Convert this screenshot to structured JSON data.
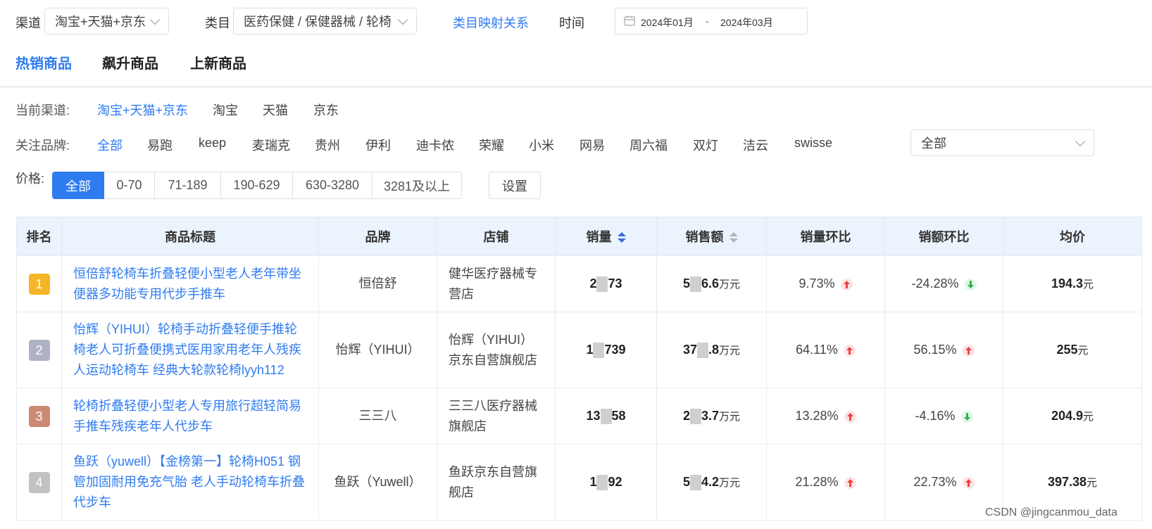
{
  "filters": {
    "channel_label": "渠道",
    "channel_value": "淘宝+天猫+京东",
    "category_label": "类目",
    "category_value": "医药保健 / 保健器械 / 轮椅",
    "mapping_link": "类目映射关系",
    "time_label": "时间",
    "date_start": "2024年01月",
    "date_sep": "-",
    "date_end": "2024年03月"
  },
  "tabs": [
    "热销商品",
    "飙升商品",
    "上新商品"
  ],
  "current_channel": {
    "label": "当前渠道:",
    "options": [
      "淘宝+天猫+京东",
      "淘宝",
      "天猫",
      "京东"
    ]
  },
  "brands": {
    "label": "关注品牌:",
    "options": [
      "全部",
      "易跑",
      "keep",
      "麦瑞克",
      "贵州",
      "伊利",
      "迪卡侬",
      "荣耀",
      "小米",
      "网易",
      "周六福",
      "双灯",
      "洁云",
      "swisse"
    ],
    "select_value": "全部"
  },
  "price": {
    "label": "价格:",
    "options": [
      "全部",
      "0-70",
      "71-189",
      "190-629",
      "630-3280",
      "3281及以上"
    ],
    "settings": "设置"
  },
  "table": {
    "headers": [
      "排名",
      "商品标题",
      "品牌",
      "店铺",
      "销量",
      "销售额",
      "销量环比",
      "销额环比",
      "均价"
    ],
    "unit_wan": "万元",
    "unit_yuan": "元",
    "rows": [
      {
        "rank": "1",
        "title": "恒倍舒轮椅车折叠轻便小型老人老年带坐便器多功能专用代步手推车",
        "brand": "恒倍舒",
        "store": "健华医疗器械专营店",
        "sales_a": "2",
        "sales_b": "73",
        "amount_a": "5",
        "amount_b": "6.6",
        "qty_mom": "9.73%",
        "qty_dir": "up",
        "amt_mom": "-24.28%",
        "amt_dir": "down",
        "avg": "194.3"
      },
      {
        "rank": "2",
        "title": "怡辉（YIHUI）轮椅手动折叠轻便手推轮椅老人可折叠便携式医用家用老年人残疾人运动轮椅车 经典大轮款轮椅lyyh112",
        "brand": "怡辉（YIHUI）",
        "store": "怡辉（YIHUI）京东自营旗舰店",
        "sales_a": "1",
        "sales_b": "739",
        "amount_a": "37",
        "amount_b": ".8",
        "qty_mom": "64.11%",
        "qty_dir": "up",
        "amt_mom": "56.15%",
        "amt_dir": "up",
        "avg": "255"
      },
      {
        "rank": "3",
        "title": "轮椅折叠轻便小型老人专用旅行超轻简易手推车残疾老年人代步车",
        "brand": "三三八",
        "store": "三三八医疗器械旗舰店",
        "sales_a": "13",
        "sales_b": "58",
        "amount_a": "2",
        "amount_b": "3.7",
        "qty_mom": "13.28%",
        "qty_dir": "up",
        "amt_mom": "-4.16%",
        "amt_dir": "down",
        "avg": "204.9"
      },
      {
        "rank": "4",
        "title": "鱼跃（yuwell）【金榜第一】轮椅H051 钢管加固耐用免充气胎 老人手动轮椅车折叠代步车",
        "brand": "鱼跃（Yuwell）",
        "store": "鱼跃京东自营旗舰店",
        "sales_a": "1",
        "sales_b": "92",
        "amount_a": "5",
        "amount_b": "4.2",
        "qty_mom": "21.28%",
        "qty_dir": "up",
        "amt_mom": "22.73%",
        "amt_dir": "up",
        "avg": "397.38"
      }
    ]
  },
  "watermark": "CSDN @jingcanmou_data",
  "colors": {
    "accent": "#2f7cf0",
    "header_bg": "#ebf3fd",
    "rank1": "#f4b627",
    "rank2": "#aeb2c4",
    "rank3": "#c98b72",
    "rank4": "#c2c2c2",
    "up": "#f04040",
    "down": "#31b14f"
  }
}
